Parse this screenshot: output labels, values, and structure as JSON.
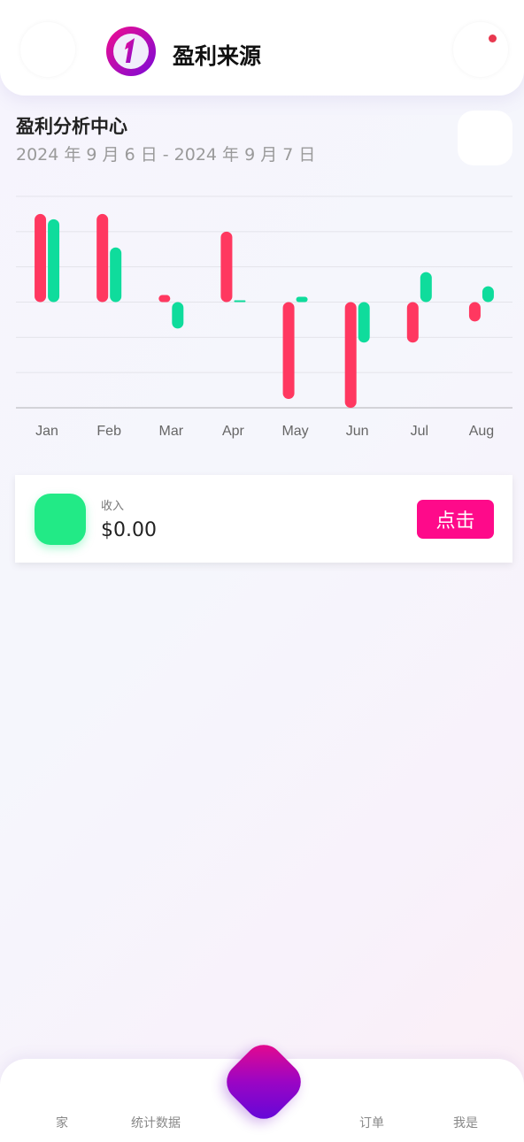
{
  "header": {
    "title": "盈利来源",
    "logo_digit": "1",
    "left_button_icon": "menu-icon",
    "right_button_icon": "notification-icon",
    "notification_dot_color": "#e8384f"
  },
  "main": {
    "section_title": "盈利分析中心",
    "date_range": "2024 年 9 月 6 日 - 2024 年 9 月 7 日",
    "calendar_icon": "calendar-icon"
  },
  "chart_data": {
    "type": "bar",
    "categories": [
      "Jan",
      "Feb",
      "Mar",
      "Apr",
      "May",
      "Jun",
      "Jul",
      "Aug"
    ],
    "series": [
      {
        "color": "#ff3860",
        "ranges": [
          [
            0,
            5
          ],
          [
            0,
            5
          ],
          [
            0,
            0.4
          ],
          [
            0,
            4
          ],
          [
            -5.5,
            0
          ],
          [
            -6,
            0
          ],
          [
            -2.3,
            0
          ],
          [
            -1.1,
            0
          ]
        ]
      },
      {
        "color": "#0fdc9c",
        "ranges": [
          [
            0,
            4.7
          ],
          [
            0,
            3.1
          ],
          [
            -1.5,
            0
          ],
          [
            0,
            0.1
          ],
          [
            0,
            0.3
          ],
          [
            -2.3,
            0
          ],
          [
            0,
            1.7
          ],
          [
            0,
            0.9
          ]
        ]
      }
    ],
    "ylim": [
      -6,
      6
    ],
    "grid": true,
    "legend": "none"
  },
  "card": {
    "label": "收入",
    "value": "$0.00",
    "button_label": "点击",
    "icon_color": "#22ea86",
    "button_color": "#fe0a8a"
  },
  "tabbar": {
    "items": [
      {
        "label": "家"
      },
      {
        "label": "统计数据"
      },
      {
        "label": "订单"
      },
      {
        "label": "我是"
      }
    ],
    "center_icon": "add-icon"
  }
}
